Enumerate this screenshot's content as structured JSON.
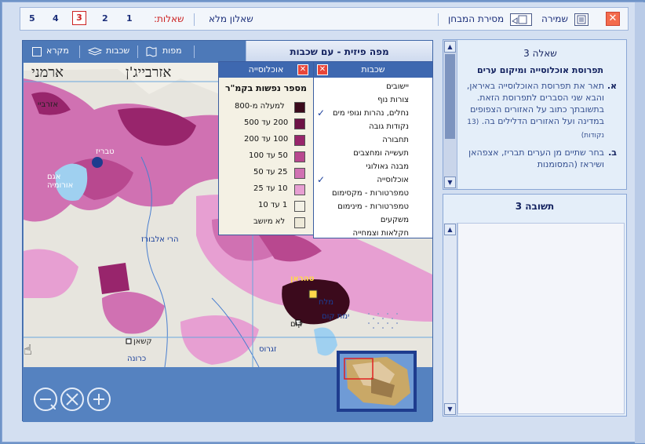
{
  "topbar": {
    "save_label": "שמירה",
    "submit_label": "מסירת המבחן",
    "full_questionnaire": "שאלון מלא",
    "questions_label": "שאלות:",
    "question_numbers": [
      "1",
      "2",
      "3",
      "4",
      "5"
    ],
    "active_question": "3"
  },
  "map": {
    "title": "מפה פיזית - עם שכבות",
    "tabs": {
      "maps": "מפות",
      "layers": "שכבות",
      "legend": "מקרא"
    },
    "place_labels": [
      "אזרבייג'ן",
      "ארמני",
      "אזרביי",
      "טבריז",
      "אגם אורומיה",
      "הרי אלבורז",
      "טהראן",
      "מלח",
      "ימת קום",
      "קום",
      "קשאן",
      "כרונה",
      "זגרוס",
      "הרבז",
      "רוג'ה"
    ]
  },
  "layers_dialog": {
    "title": "שכבות",
    "items": [
      {
        "label": "יישובים",
        "checked": false
      },
      {
        "label": "צורות נוף",
        "checked": false
      },
      {
        "label": "נחלים, נהרות וגופי מים",
        "checked": true
      },
      {
        "label": "נקודות גובה",
        "checked": false
      },
      {
        "label": "תחבורה",
        "checked": false
      },
      {
        "label": "תעשייה ומחצבים",
        "checked": false
      },
      {
        "label": "מבנה גאולוגי",
        "checked": false
      },
      {
        "label": "אוכלוסייה",
        "checked": true
      },
      {
        "label": "טמפרטורות - מקסימום",
        "checked": false
      },
      {
        "label": "טמפרטורות - מינימום",
        "checked": false
      },
      {
        "label": "משקעים",
        "checked": false
      },
      {
        "label": "חקלאות וצמחייה",
        "checked": false
      }
    ],
    "check_glyph": "✓"
  },
  "population_dialog": {
    "title": "אוכלוסייה",
    "subtitle": "מספר נפשות בקמ\"ר",
    "rows": [
      {
        "label": "למעלה מ-800",
        "color": "#3b0a1c"
      },
      {
        "label": "200 עד 500",
        "color": "#6d1246"
      },
      {
        "label": "100 עד 200",
        "color": "#98256c"
      },
      {
        "label": "50 עד 100",
        "color": "#b8488f"
      },
      {
        "label": "25 עד 50",
        "color": "#d071b2"
      },
      {
        "label": "10 עד 25",
        "color": "#e79fd2"
      },
      {
        "label": "1 עד 10",
        "color": "#f3f1e6"
      },
      {
        "label": "לא מיושב",
        "color": "#ede9d8"
      }
    ]
  },
  "question": {
    "title": "שאלה 3",
    "subtitle": "תפרוסת אוכלוסייה ומיקום ערים",
    "part_a_letter": "א.",
    "part_a_text": "תאר את תפרוסת האוכלוסייה באיראן, והבא שני הסברים לתפרוסת הזאת. בתשובתך כתוב על האזורים הצפופים במדינה ועל האזורים הדלילים בה.",
    "part_a_points": "(13 נקודות)",
    "part_b_letter": "ב.",
    "part_b_text": "בחר שתיים מן הערים תבריז, אצפהאן ושיראז (המסומנות"
  },
  "answer": {
    "title": "תשובה 3"
  },
  "colors": {
    "accent": "#3e68b0",
    "map_bg": "#5582c0",
    "close_red": "#f36b4c"
  }
}
